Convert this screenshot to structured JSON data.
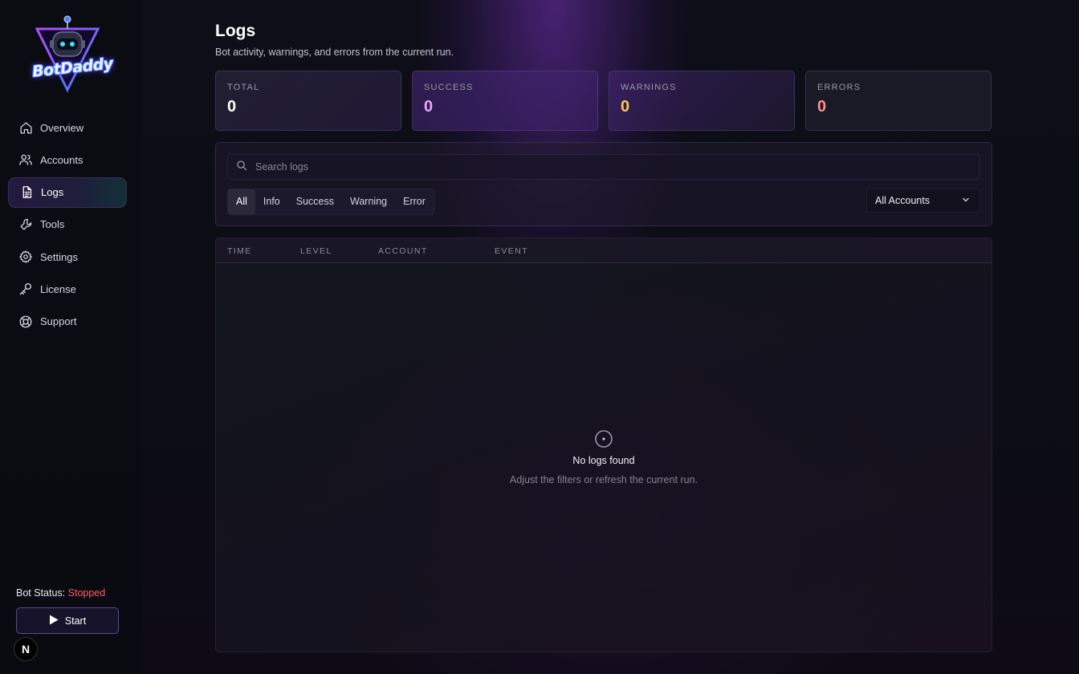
{
  "brand": {
    "logo_text": "BotDaddy"
  },
  "sidebar": {
    "items": [
      {
        "label": "Overview",
        "icon": "home-icon"
      },
      {
        "label": "Accounts",
        "icon": "users-icon"
      },
      {
        "label": "Logs",
        "icon": "document-icon",
        "active": true
      },
      {
        "label": "Tools",
        "icon": "wrench-icon"
      },
      {
        "label": "Settings",
        "icon": "gear-icon"
      },
      {
        "label": "License",
        "icon": "key-icon"
      },
      {
        "label": "Support",
        "icon": "lifebuoy-icon"
      }
    ],
    "status_label": "Bot Status:",
    "status_value": "Stopped",
    "start_label": "Start",
    "badge": "N"
  },
  "page": {
    "title": "Logs",
    "subtitle": "Bot activity, warnings, and errors from the current run."
  },
  "stats": [
    {
      "label": "TOTAL",
      "value": "0",
      "color": "#ffffff"
    },
    {
      "label": "SUCCESS",
      "value": "0",
      "color": "#e7a8ff"
    },
    {
      "label": "WARNINGS",
      "value": "0",
      "color": "#ffc94a"
    },
    {
      "label": "ERRORS",
      "value": "0",
      "color": "#ff8f8f"
    }
  ],
  "filters": {
    "search_placeholder": "Search logs",
    "tabs": [
      "All",
      "Info",
      "Success",
      "Warning",
      "Error"
    ],
    "active_tab": "All",
    "account_select": "All Accounts"
  },
  "table": {
    "columns": [
      "TIME",
      "LEVEL",
      "ACCOUNT",
      "EVENT"
    ],
    "empty_title": "No logs found",
    "empty_subtitle": "Adjust the filters or refresh the current run."
  },
  "colors": {
    "accent": "#7b3cff",
    "status_stopped": "#ff5b6e"
  }
}
